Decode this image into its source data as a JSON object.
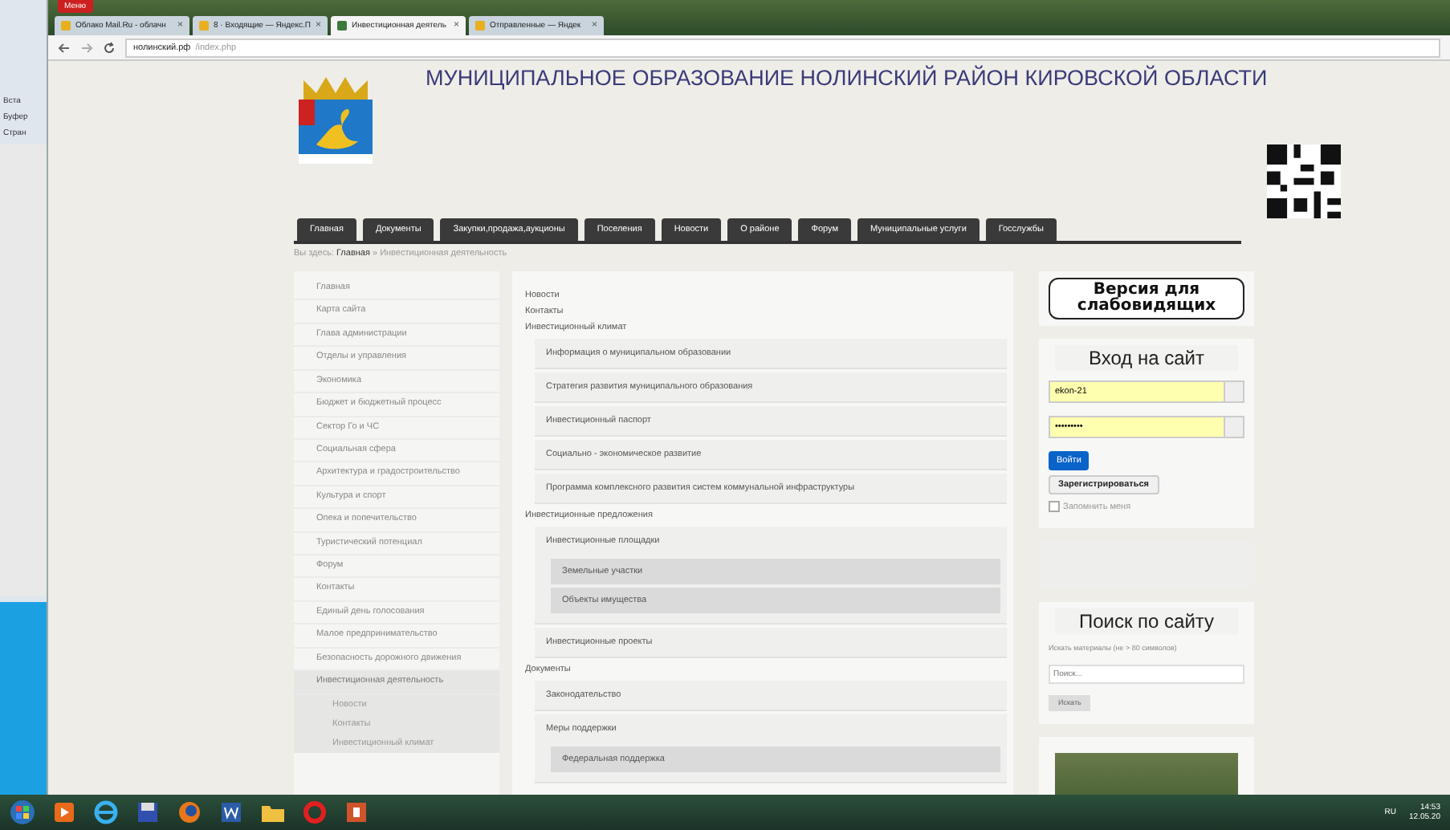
{
  "desktop_strip": {
    "texts": [
      "Вста",
      "Буфер",
      "Стран"
    ]
  },
  "browser": {
    "menu_button": "Меню",
    "tabs": [
      {
        "title": "Облако Mail.Ru - облачн",
        "close": "×",
        "selected": false
      },
      {
        "title": "8 · Входящие — Яндекс.П",
        "close": "×",
        "selected": false
      },
      {
        "title": "Инвестиционная деятель",
        "close": "×",
        "selected": true
      },
      {
        "title": "Отправленные — Яндек",
        "close": "×",
        "selected": false
      }
    ],
    "address": {
      "host": "нолинский.рф",
      "path": "/index.php"
    }
  },
  "header": {
    "title": "МУНИЦИПАЛЬНОЕ ОБРАЗОВАНИЕ НОЛИНСКИЙ РАЙОН КИРОВСКОЙ ОБЛАСТИ"
  },
  "nav": [
    {
      "label": "Главная",
      "selected": false
    },
    {
      "label": "Документы",
      "selected": false
    },
    {
      "label": "Закупки,продажа,аукционы",
      "selected": false
    },
    {
      "label": "Поселения",
      "selected": false
    },
    {
      "label": "Новости",
      "selected": false
    },
    {
      "label": "О районе",
      "selected": false
    },
    {
      "label": "Форум",
      "selected": false
    },
    {
      "label": "Муниципальные услуги",
      "selected": false
    },
    {
      "label": "Госслужбы",
      "selected": false
    }
  ],
  "breadcrumb": {
    "prefix": "Вы здесь:",
    "home": "Главная",
    "separator": "»",
    "current": "Инвестиционная деятельность"
  },
  "sidebar": {
    "items": [
      {
        "label": "Главная",
        "selected": false
      },
      {
        "label": "Карта сайта",
        "selected": false
      },
      {
        "label": "Глава администрации",
        "selected": false
      },
      {
        "label": "Отделы и управления",
        "selected": false
      },
      {
        "label": "Экономика",
        "selected": false
      },
      {
        "label": "Бюджет и бюджетный процесс",
        "selected": false
      },
      {
        "label": "Сектор Го и ЧС",
        "selected": false
      },
      {
        "label": "Социальная сфера",
        "selected": false
      },
      {
        "label": "Архитектура и градостроительство",
        "selected": false
      },
      {
        "label": "Культура и спорт",
        "selected": false
      },
      {
        "label": "Опека и попечительство",
        "selected": false
      },
      {
        "label": "Туристический потенциал",
        "selected": false
      },
      {
        "label": "Форум",
        "selected": false
      },
      {
        "label": "Контакты",
        "selected": false
      },
      {
        "label": "Единый день голосования",
        "selected": false
      },
      {
        "label": "Малое предпринимательство",
        "selected": false
      },
      {
        "label": "Безопасность дорожного движения",
        "selected": false
      },
      {
        "label": "Инвестиционная деятельность",
        "selected": true,
        "children": [
          {
            "label": "Новости"
          },
          {
            "label": "Контакты"
          },
          {
            "label": "Инвестиционный климат"
          }
        ]
      }
    ]
  },
  "content": {
    "items": [
      {
        "label": "Новости"
      },
      {
        "label": "Контакты"
      },
      {
        "label": "Инвестиционный климат",
        "children": [
          {
            "label": "Информация о муниципальном образовании"
          },
          {
            "label": "Стратегия развития муниципального образования"
          },
          {
            "label": "Инвестиционный паспорт"
          },
          {
            "label": "Социально - экономическое развитие"
          },
          {
            "label": "Программа комплексного развития систем коммунальной инфраструктуры"
          }
        ]
      },
      {
        "label": "Инвестиционные предложения",
        "children": [
          {
            "label": "Инвестиционные площадки",
            "children": [
              {
                "label": "Земельные участки"
              },
              {
                "label": "Объекты имущества"
              }
            ]
          },
          {
            "label": "Инвестиционные проекты"
          }
        ]
      },
      {
        "label": "Документы",
        "children": [
          {
            "label": "Законодательство"
          },
          {
            "label": "Меры поддержки",
            "children": [
              {
                "label": "Федеральная поддержка"
              }
            ]
          }
        ]
      }
    ]
  },
  "right": {
    "accessibility_button": "Версия для слабовидящих",
    "login": {
      "title": "Вход на сайт",
      "username": "ekon-21",
      "password": "•••••••••",
      "login_button": "Войти",
      "register_button": "Зарегистрироваться",
      "remember": {
        "label": "Запомнить меня",
        "checked": false
      }
    },
    "search": {
      "title": "Поиск по сайту",
      "label": "Искать материалы (не > 80 символов)",
      "placeholder": "Поиск...",
      "button": "Искать"
    }
  },
  "taskbar": {
    "language": "RU",
    "time": "14:53",
    "date": "12.05.20"
  }
}
